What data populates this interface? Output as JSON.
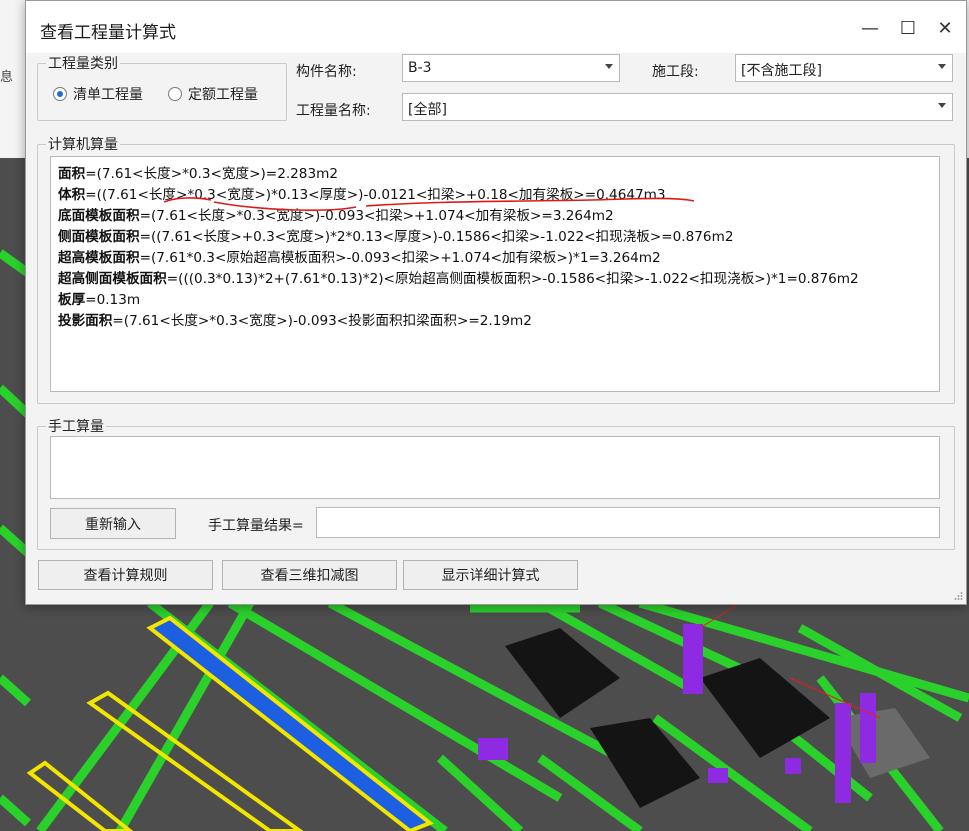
{
  "background": {
    "side_text": "息",
    "colors": {
      "floor": "#4d4d4d",
      "beam": "#2bd12b",
      "purple": "#8e2be2",
      "yellow": "#f2e600",
      "blue": "#1c5fe0"
    }
  },
  "dialog": {
    "title": "查看工程量计算式",
    "controls": {
      "minimize": "—",
      "maximize": "☐",
      "close": "✕"
    }
  },
  "category": {
    "legend": "工程量类别",
    "options": [
      {
        "label": "清单工程量",
        "selected": true
      },
      {
        "label": "定额工程量",
        "selected": false
      }
    ]
  },
  "fields": {
    "component_label": "构件名称:",
    "component_value": "B-3",
    "stage_label": "施工段:",
    "stage_value": "[不含施工段]",
    "quantity_label": "工程量名称:",
    "quantity_value": "[全部]"
  },
  "computer_calc": {
    "legend": "计算机算量",
    "lines": [
      {
        "key": "面积",
        "expr": "=(7.61<长度>*0.3<宽度>)=2.283m2"
      },
      {
        "key": "体积",
        "expr": "=((7.61<长度>*0.3<宽度>)*0.13<厚度>)-0.0121<扣梁>+0.18<加有梁板>=0.4647m3"
      },
      {
        "key": "底面模板面积",
        "expr": "=(7.61<长度>*0.3<宽度>)-0.093<扣梁>+1.074<加有梁板>=3.264m2"
      },
      {
        "key": "侧面模板面积",
        "expr": "=((7.61<长度>+0.3<宽度>)*2*0.13<厚度>)-0.1586<扣梁>-1.022<扣现浇板>=0.876m2"
      },
      {
        "key": "超高模板面积",
        "expr": "=(7.61*0.3<原始超高模板面积>-0.093<扣梁>+1.074<加有梁板>)*1=3.264m2"
      },
      {
        "key": "超高侧面模板面积",
        "expr": "=(((0.3*0.13)*2+(7.61*0.13)*2)<原始超高侧面模板面积>-0.1586<扣梁>-1.022<扣现浇板>)*1=0.876m2"
      },
      {
        "key": "板厚",
        "expr": "=0.13m"
      },
      {
        "key": "投影面积",
        "expr": "=(7.61<长度>*0.3<宽度>)-0.093<投影面积扣梁面积>=2.19m2"
      }
    ]
  },
  "manual_calc": {
    "legend": "手工算量",
    "reenter_button": "重新输入",
    "result_label": "手工算量结果=",
    "result_value": ""
  },
  "bottom_buttons": {
    "rules": "查看计算规则",
    "view3d": "查看三维扣减图",
    "detail": "显示详细计算式"
  }
}
